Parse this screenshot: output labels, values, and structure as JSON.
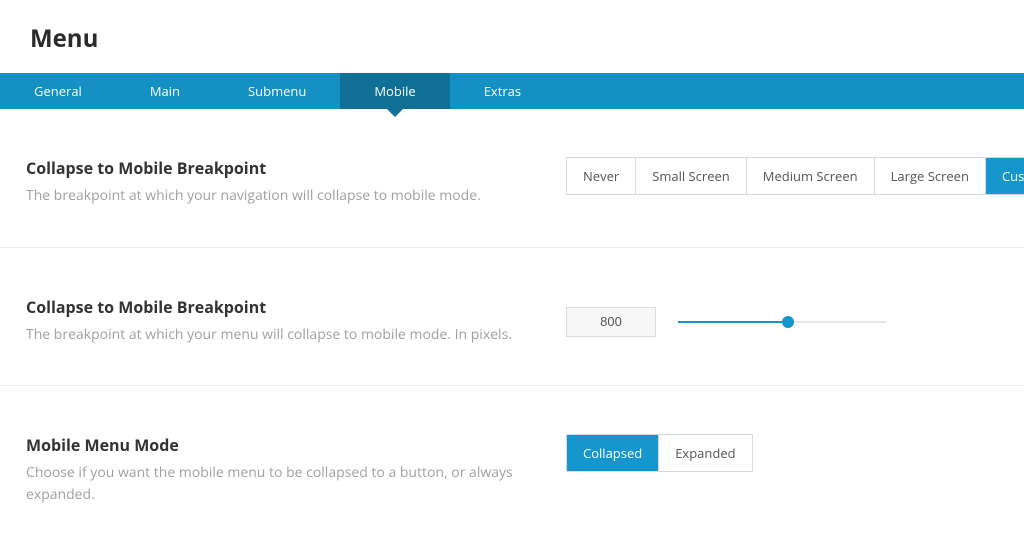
{
  "page": {
    "title": "Menu"
  },
  "tabs": {
    "items": [
      {
        "label": "General"
      },
      {
        "label": "Main"
      },
      {
        "label": "Submenu"
      },
      {
        "label": "Mobile"
      },
      {
        "label": "Extras"
      }
    ],
    "active": "Mobile"
  },
  "settings": {
    "breakpointMode": {
      "title": "Collapse to Mobile Breakpoint",
      "desc": "The breakpoint at which your navigation will collapse to mobile mode.",
      "options": [
        "Never",
        "Small Screen",
        "Medium Screen",
        "Large Screen",
        "Custom"
      ],
      "selected": "Custom"
    },
    "breakpointPx": {
      "title": "Collapse to Mobile Breakpoint",
      "desc": "The breakpoint at which your menu will collapse to mobile mode. In pixels.",
      "value": "800",
      "sliderPercent": 53
    },
    "menuMode": {
      "title": "Mobile Menu Mode",
      "desc": "Choose if you want the mobile menu to be collapsed to a button, or always expanded.",
      "options": [
        "Collapsed",
        "Expanded"
      ],
      "selected": "Collapsed"
    }
  }
}
